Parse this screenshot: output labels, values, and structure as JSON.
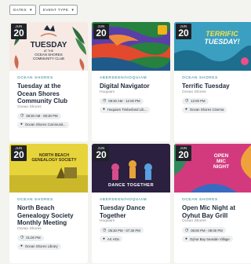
{
  "filters": [
    {
      "label": "DATES",
      "icon": "chevron-down-icon"
    },
    {
      "label": "EVENT TYPE",
      "icon": "chevron-down-icon"
    }
  ],
  "events": [
    {
      "month": "JUN",
      "day": "20",
      "location": "OCEAN SHORES",
      "title": "Tuesday at the Ocean Shores Community Club",
      "venue": "Ocean Shores",
      "time": "08:30 AM - 08:30 PM",
      "place": "Ocean Shores Communit...",
      "image_text": [
        "TUESDAY",
        "AT THE",
        "OCEAN SHORES",
        "COMMUNITY CLUB"
      ]
    },
    {
      "month": "JUN",
      "day": "20",
      "location": "ABERDEEN/HOQUIAM",
      "title": "Digital Navigator",
      "venue": "Hoquiam",
      "time": "08:30 AM - 12:00 PM",
      "place": "Hoquiam Timberland Lib..."
    },
    {
      "month": "JUN",
      "day": "20",
      "location": "OCEAN SHORES",
      "title": "Terrific Tuesday",
      "venue": "Ocean Shores",
      "time": "12:00 PM",
      "place": "Ocean Shores Cinema",
      "image_text": [
        "TERRIFIC",
        "TUESDAY!"
      ]
    },
    {
      "month": "JUN",
      "day": "20",
      "location": "OCEAN SHORES",
      "title": "North Beach Genealogy Society Monthly Meeting",
      "venue": "Ocean Shores",
      "time": "01:00 PM",
      "place": "Ocean Shores Library",
      "image_text": [
        "NORTH BEACH",
        "GENEALOGY SOCIETY"
      ]
    },
    {
      "month": "JUN",
      "day": "20",
      "location": "ABERDEEN/HOQUIAM",
      "title": "Tuesday Dance Together",
      "venue": "Hoquiam",
      "time": "05:30 PM - 07:30 PM",
      "place": "Art HOx",
      "image_text": [
        "DANCE TOGETHER"
      ]
    },
    {
      "month": "JUN",
      "day": "20",
      "location": "OCEAN SHORES",
      "title": "Open Mic Night at Oyhut Bay Grill",
      "venue": "Ocean Shores",
      "time": "06:00 PM - 09:00 PM",
      "place": "Oyhut Bay Seaside Village",
      "image_text": [
        "OPEN",
        "MIC",
        "NIGHT"
      ]
    }
  ],
  "icons": {
    "time": "clock-icon",
    "place": "map-pin-icon"
  },
  "colors": {
    "location": "#1b7f8a",
    "title": "#1e2a3a",
    "date_badge": "#1f2328",
    "background": "#f3f3ef"
  }
}
